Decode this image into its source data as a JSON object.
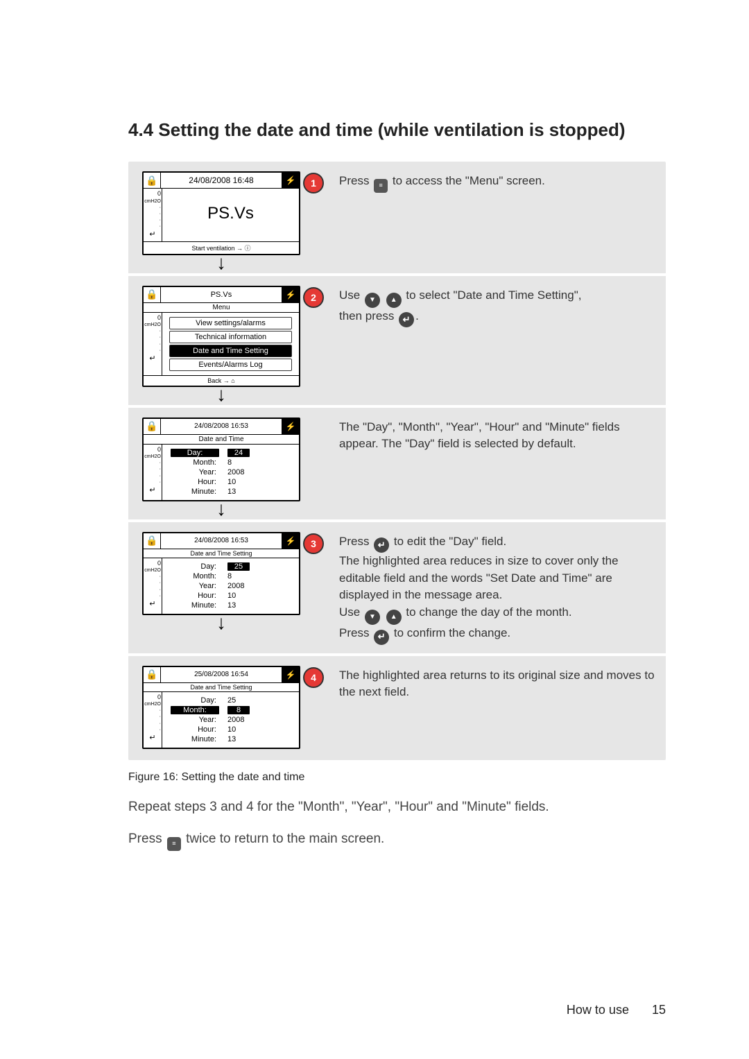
{
  "section": {
    "number": "4.4",
    "title": "Setting the date and time (while ventilation is stopped)"
  },
  "steps": {
    "s1": {
      "badge": "1",
      "text_before": "Press ",
      "text_after": " to access the \"Menu\" screen.",
      "screen": {
        "header_date": "24/08/2008  16:48",
        "mode": "PS.Vs",
        "footer": "Start ventilation  → ⓘ"
      }
    },
    "s2": {
      "badge": "2",
      "t1": "Use ",
      "t2": " to select \"Date and Time Setting\",",
      "t3": "then press ",
      "t4": ".",
      "screen": {
        "header_title": "PS.Vs",
        "sub": "Menu",
        "items": [
          "View settings/alarms",
          "Technical information",
          "Date and Time Setting",
          "Events/Alarms Log"
        ],
        "sel_index": 2,
        "footer": "Back → ⌂"
      }
    },
    "s3": {
      "text": "The \"Day\", \"Month\", \"Year\", \"Hour\" and \"Minute\" fields appear. The \"Day\" field is selected by default.",
      "screen": {
        "header_date": "24/08/2008   16:53",
        "sub": "Date and Time",
        "fields": {
          "Day": "24",
          "Month": "8",
          "Year": "2008",
          "Hour": "10",
          "Minute": "13"
        },
        "sel": "Day"
      }
    },
    "s4": {
      "badge": "3",
      "l1a": "Press ",
      "l1b": " to edit the \"Day\" field.",
      "l2": "The highlighted area reduces in size to cover only the editable field and the words \"Set Date and Time\" are displayed in the message area.",
      "l3a": "Use ",
      "l3b": " to change the day of the month.",
      "l4a": "Press ",
      "l4b": " to confirm the change.",
      "screen": {
        "header_date": "24/08/2008   16:53",
        "sub": "Date and Time Setting",
        "fields": {
          "Day": "25",
          "Month": "8",
          "Year": "2008",
          "Hour": "10",
          "Minute": "13"
        },
        "sel": "Day",
        "sel_value_only": true
      }
    },
    "s5": {
      "badge": "4",
      "text": "The highlighted area returns to its original size and moves to the next field.",
      "screen": {
        "header_date": "25/08/2008   16:54",
        "sub": "Date and Time Setting",
        "fields": {
          "Day": "25",
          "Month": "8",
          "Year": "2008",
          "Hour": "10",
          "Minute": "13"
        },
        "sel": "Month"
      }
    }
  },
  "figure_caption": "Figure 16: Setting the date and time",
  "para_after_1": "Repeat steps 3 and 4 for the \"Month\", \"Year\", \"Hour\" and \"Minute\" fields.",
  "para_after_2a": "Press ",
  "para_after_2b": " twice to return to the main screen.",
  "footer": {
    "label": "How to use",
    "page": "15"
  },
  "scale": {
    "zero": "0",
    "unit": "cmH2O",
    "bot": "↵"
  }
}
